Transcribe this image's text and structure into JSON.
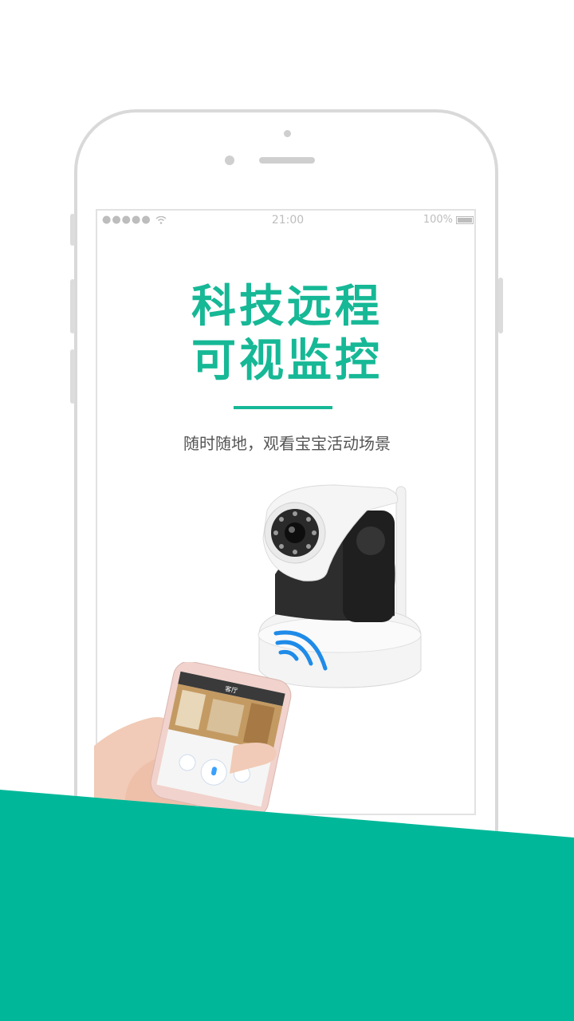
{
  "status_bar": {
    "signal": "●●●●● ",
    "time": "21:00",
    "battery": "100%"
  },
  "headline": {
    "line1": "科技远程",
    "line2": "可视监控"
  },
  "subtitle": "随时随地，观看宝宝活动场景",
  "phone_app": {
    "title": "客厅"
  },
  "colors": {
    "accent": "#16b896",
    "band": "#00b899"
  }
}
